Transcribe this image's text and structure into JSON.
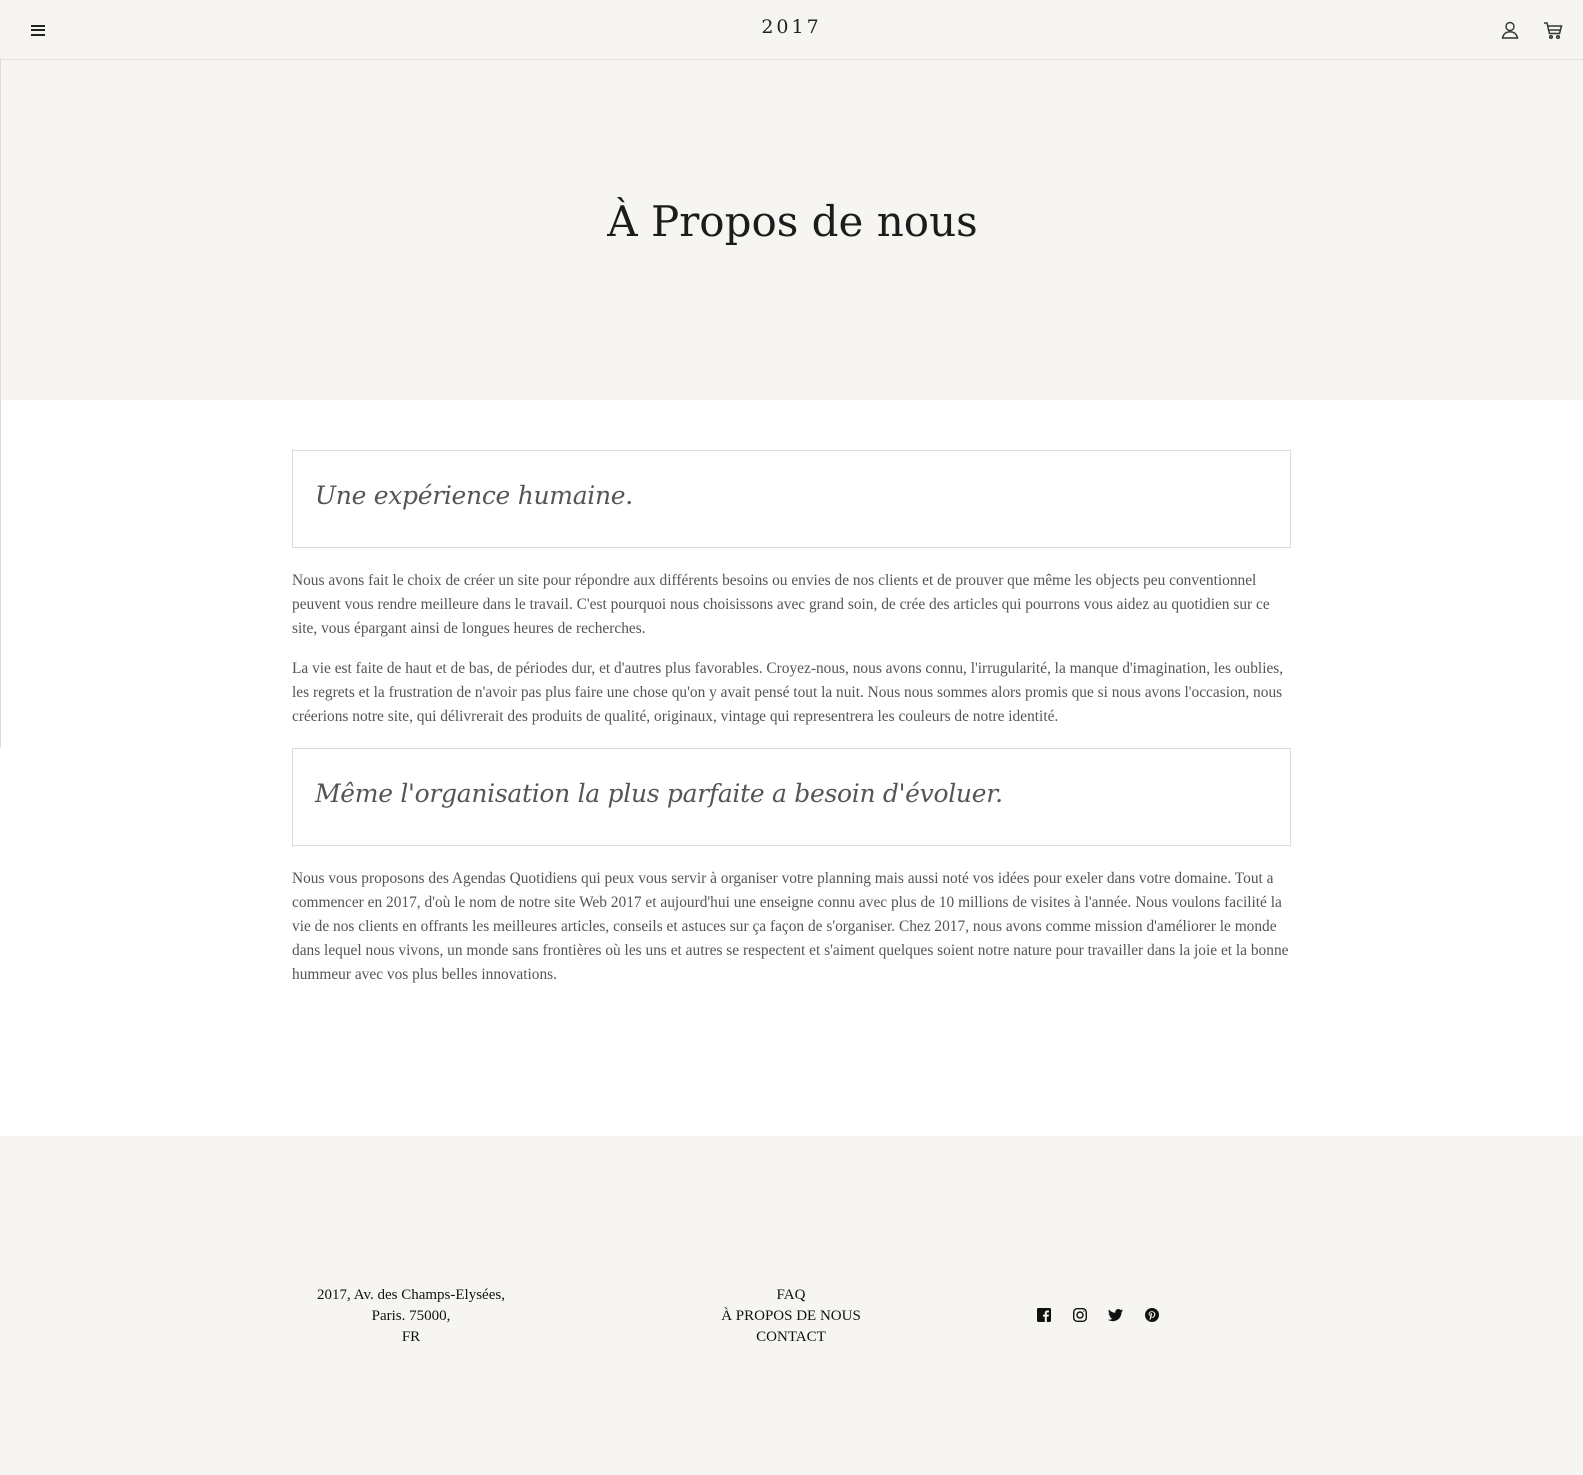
{
  "header": {
    "logo": "2017",
    "icons": [
      "menu-icon",
      "user-icon",
      "cart-icon"
    ]
  },
  "hero": {
    "title": "À Propos de nous"
  },
  "sections": [
    {
      "heading": "Une expérience humaine.",
      "paragraphs": [
        "Nous avons fait le choix de créer un site pour répondre aux différents besoins ou envies de nos clients et de prouver que même les objects peu conventionnel peuvent vous rendre meilleure dans le travail. C'est pourquoi nous choisissons avec grand soin, de crée des articles qui pourrons vous aidez au quotidien sur ce site, vous épargant ainsi de longues heures de recherches.",
        "La vie est faite de haut et de bas, de périodes dur, et d'autres plus favorables. Croyez-nous, nous avons connu, l'irrugularité, la manque d'imagination, les oublies, les regrets et la frustration de n'avoir pas plus faire une chose qu'on y avait pensé tout la nuit. Nous nous sommes alors promis que si nous avons l'occasion, nous créerions notre site, qui délivrerait des produits de qualité, originaux, vintage qui representrera les couleurs de notre identité."
      ]
    },
    {
      "heading": "Même l'organisation la plus parfaite a besoin d'évoluer.",
      "paragraphs": [
        "Nous vous proposons des Agendas Quotidiens qui peux vous servir à organiser votre planning mais aussi noté vos idées pour exeler dans votre domaine. Tout a commencer en 2017, d'où le nom de notre site Web 2017 et aujourd'hui une enseigne connu avec plus de 10 millions de visites à l'année. Nous voulons facilité la vie de nos clients en offrants les meilleures articles, conseils et astuces sur ça façon de s'organiser. Chez 2017, nous avons comme mission d'améliorer le monde dans lequel nous vivons, un monde sans frontières où les uns et autres se respectent et s'aiment quelques soient notre nature pour travailler dans la joie et la bonne hummeur avec vos plus belles innovations."
      ]
    }
  ],
  "footer": {
    "address": [
      "2017, Av. des Champs-Elysées,",
      "Paris. 75000,",
      "FR"
    ],
    "links": [
      "FAQ",
      "À PROPOS DE NOUS",
      "CONTACT"
    ],
    "social": [
      "facebook-icon",
      "instagram-icon",
      "twitter-icon",
      "pinterest-icon"
    ]
  }
}
